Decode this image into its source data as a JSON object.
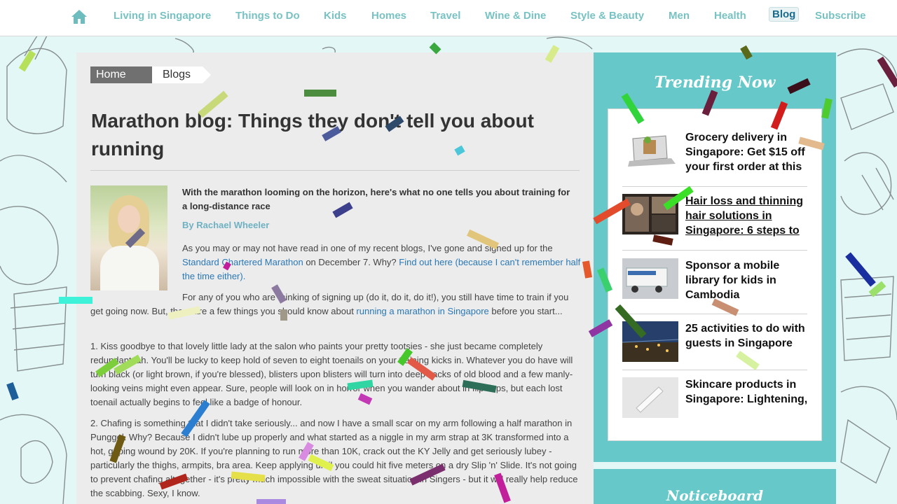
{
  "nav": {
    "home_icon": "home-icon",
    "items": [
      {
        "label": "Living in Singapore"
      },
      {
        "label": "Things to Do"
      },
      {
        "label": "Kids"
      },
      {
        "label": "Homes"
      },
      {
        "label": "Travel"
      },
      {
        "label": "Wine & Dine"
      },
      {
        "label": "Style & Beauty"
      },
      {
        "label": "Men"
      },
      {
        "label": "Health"
      },
      {
        "label": "Blog",
        "active": true
      },
      {
        "label": "Subscribe"
      }
    ]
  },
  "breadcrumb": {
    "home": "Home",
    "current": "Blogs"
  },
  "article": {
    "title": "Marathon blog: Things they don't tell you about running",
    "intro": "With the marathon looming on the horizon, here's what no one tells you about training for a long-distance race",
    "byline": "By Rachael Wheeler",
    "p1_a": "As you may or may not have read in one of my recent blogs, I've gone and signed up for the ",
    "p1_link1": "Standard Chartered Marathon",
    "p1_b": " on December 7. Why? ",
    "p1_link2": "Find out here (because I can't remember half the time either).",
    "p2_a": "For any of you who are thinking of signing up (do it, do it, do it!), you still have time to train if you get going now. But, there are a few things you should know about ",
    "p2_link": "running a marathon in Singapore",
    "p2_b": " before you start...",
    "p3": "1. Kiss goodbye to that lovely little lady at the salon who paints your pretty tootsies - she just became completely redundant lah. You'll be lucky to keep hold of seven to eight toenails on your training kicks in. Whatever you do have will turn black (or light brown, if you're blessed), blisters upon blisters will turn into deep sacks of old blood and a few manly-looking veins might even appear. Sure, people will look on in horror when you wander about in flip flops, but each lost toenail actually begins to feel like a badge of honour.",
    "p4": "2. Chafing is something that I didn't take seriously... and now I have a small scar on my arm following a half marathon in Punggol. Why? Because I didn't lube up properly and what started as a niggle in my arm strap at 3K transformed into a hot, gaping wound by 20K. If you're planning to run more than 10K, crack out the KY Jelly and get seriously lubey - particularly the thighs, armpits, bra area. Keep applying until you could hit five meters on a dry Slip 'n' Slide. It's not going to prevent chafing altogether - it's pretty much impossible with the sweat situation in Singers - but it will really help reduce the scabbing. Sexy, I know."
  },
  "sidebar": {
    "heading": "Trending Now",
    "items": [
      {
        "title": "Grocery delivery in Singapore: Get $15 off your first order at this",
        "thumb": "laptop-grocery"
      },
      {
        "title": "Hair loss and thinning hair solutions in Singapore: 6 steps to",
        "thumb": "hair-collage",
        "underlined": true
      },
      {
        "title": "Sponsor a mobile library for kids in Cambodia",
        "thumb": "library-truck"
      },
      {
        "title": "25 activities to do with guests in Singapore",
        "thumb": "city-night"
      },
      {
        "title": "Skincare products in Singapore: Lightening,",
        "thumb": "skincare-bottle"
      }
    ],
    "noticeboard": "Noticeboard"
  },
  "colors": {
    "accent_teal": "#66c8c8",
    "nav_text": "#78c2c4",
    "link": "#2a78b6",
    "byline": "#6fb1c2"
  }
}
